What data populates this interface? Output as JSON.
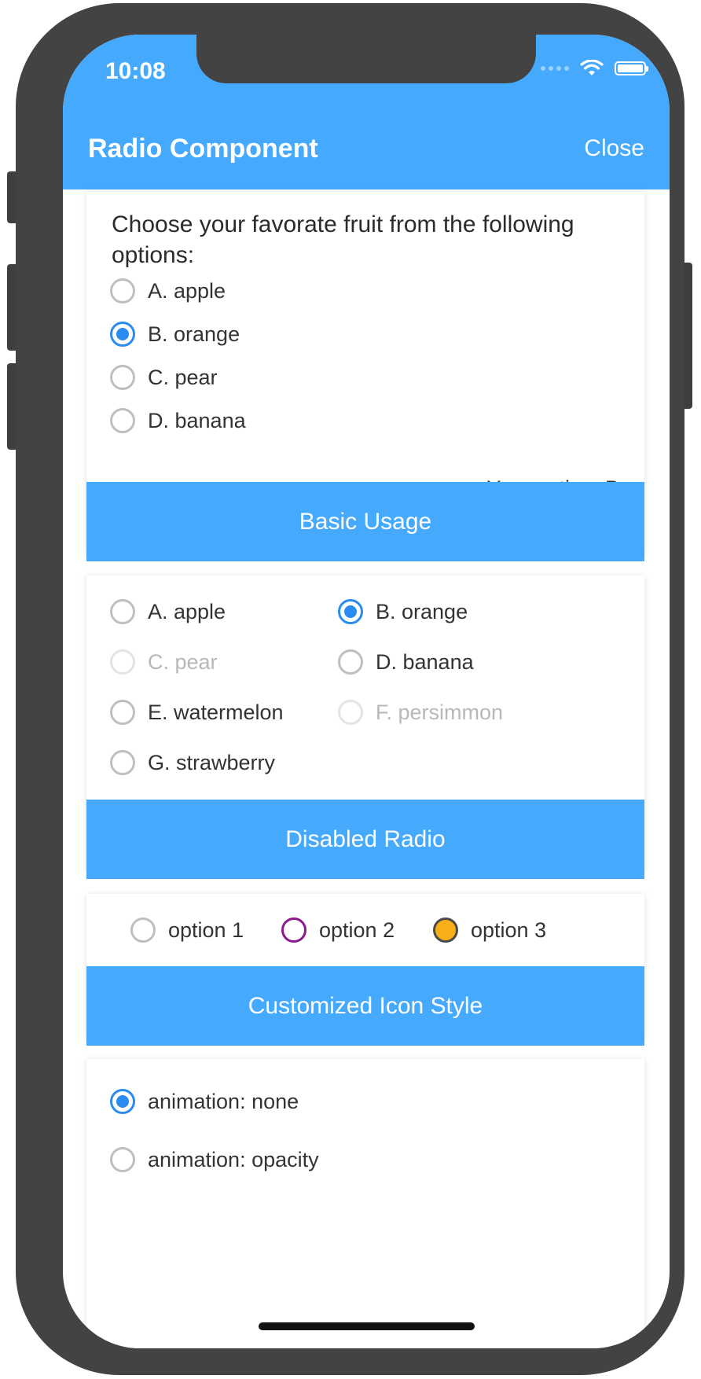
{
  "status_bar": {
    "time": "10:08"
  },
  "nav": {
    "title": "Radio Component",
    "close_label": "Close"
  },
  "basic": {
    "question": "Choose your favorate fruit from the following options:",
    "options": [
      "A. apple",
      "B. orange",
      "C. pear",
      "D. banana"
    ],
    "selected": "B",
    "answer": "Your option: B",
    "button": "Basic Usage"
  },
  "disabled": {
    "options": [
      "A. apple",
      "B. orange",
      "C. pear",
      "D. banana",
      "E. watermelon",
      "F. persimmon",
      "G. strawberry"
    ],
    "disabled_options": [
      "C. pear",
      "F. persimmon"
    ],
    "selected": "B. orange",
    "button": "Disabled Radio"
  },
  "custom": {
    "options": [
      "option 1",
      "option 2",
      "option 3"
    ],
    "button": "Customized Icon Style"
  },
  "animation": {
    "options": [
      "animation: none",
      "animation: opacity"
    ],
    "selected": "animation: none"
  },
  "colors": {
    "accent": "#45a9fe",
    "checked": "#2a8cf0",
    "purple": "#8a1a8d",
    "orange": "#f8ae17"
  }
}
